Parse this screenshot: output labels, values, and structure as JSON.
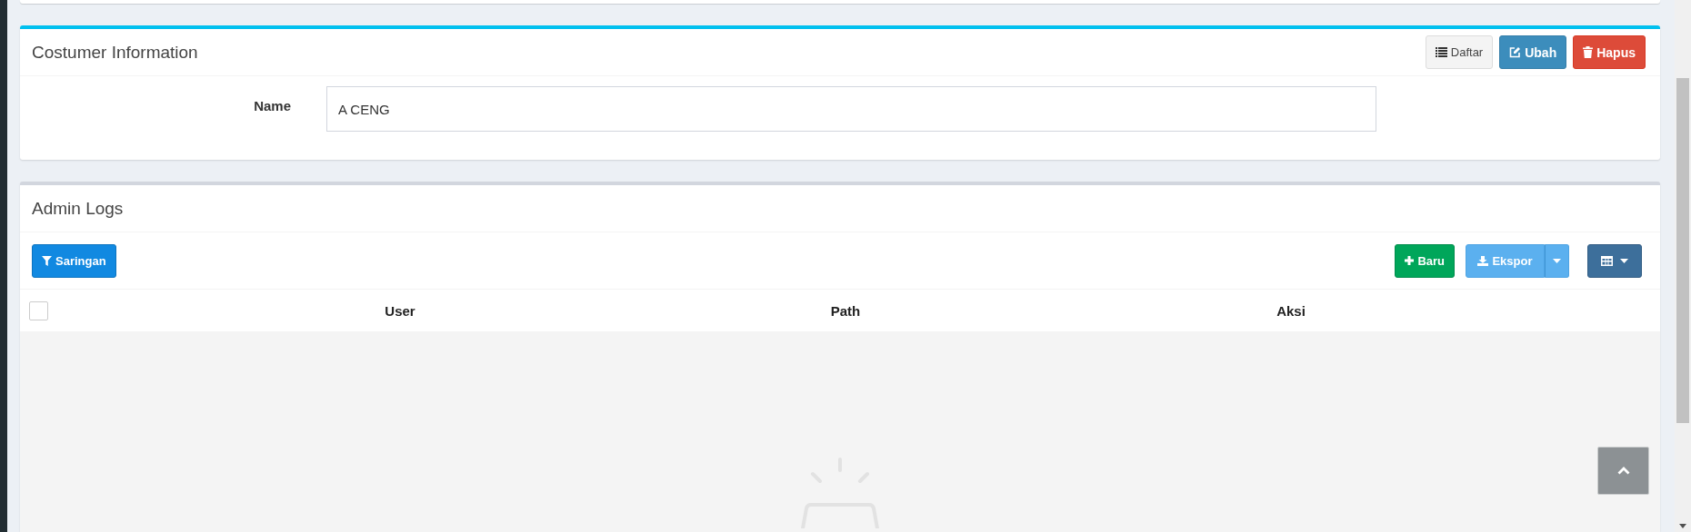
{
  "customer_card": {
    "title": "Costumer Information",
    "buttons": [
      {
        "kind": "list",
        "label": "Daftar"
      },
      {
        "kind": "edit",
        "label": "Ubah"
      },
      {
        "kind": "delete",
        "label": "Hapus"
      }
    ],
    "fields": [
      {
        "label": "Name",
        "value": "A CENG"
      }
    ]
  },
  "admin_logs": {
    "title": "Admin Logs",
    "filter_button": "Saringan",
    "new_button": "Baru",
    "export_button": "Ekspor",
    "table": {
      "select_all_checked": false,
      "columns": [
        "User",
        "Path",
        "Aksi"
      ]
    }
  }
}
